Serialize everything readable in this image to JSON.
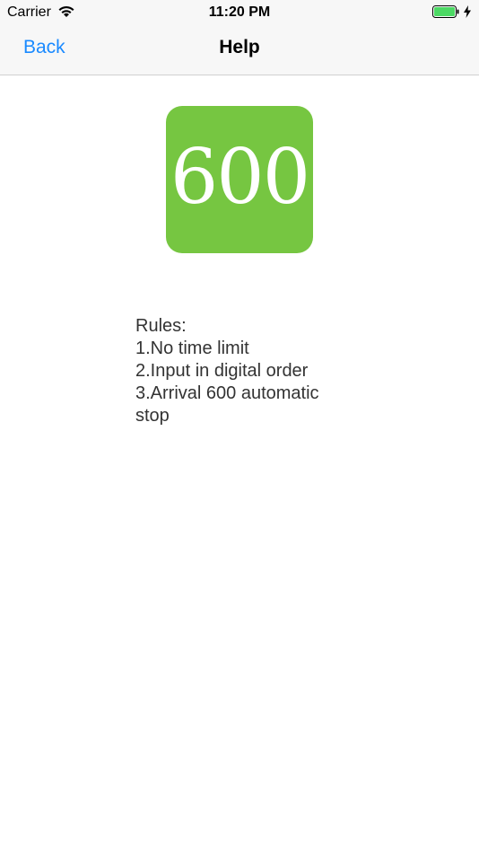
{
  "status_bar": {
    "carrier": "Carrier",
    "time": "11:20 PM",
    "battery_color": "#4cd964"
  },
  "nav": {
    "back_label": "Back",
    "title": "Help",
    "tint_color": "#1a8aff"
  },
  "logo": {
    "text": "600",
    "background": "#76c641"
  },
  "rules": {
    "heading": "Rules:",
    "line1": "1.No time limit",
    "line2": "2.Input in digital order",
    "line3": "3.Arrival 600 automatic stop"
  }
}
